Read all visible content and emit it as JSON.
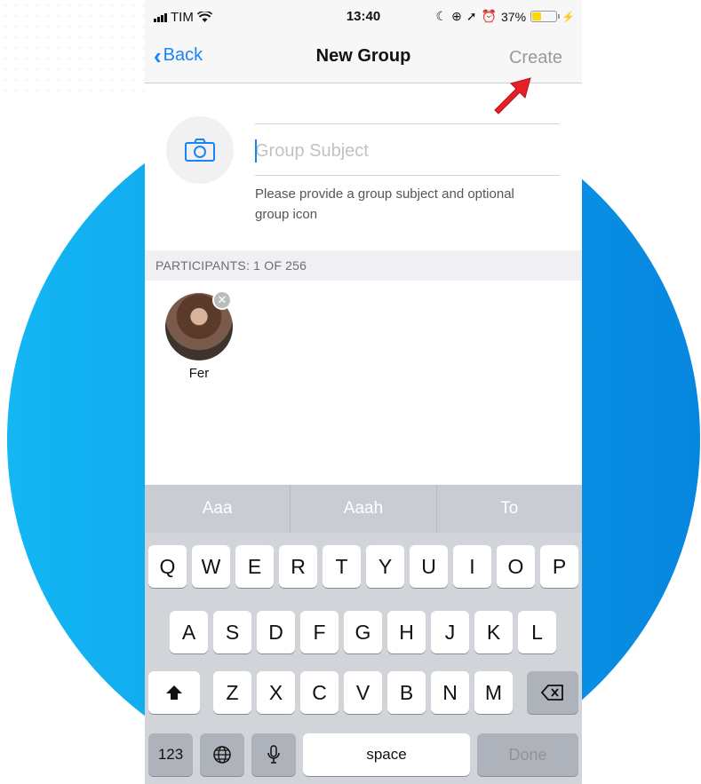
{
  "status_bar": {
    "carrier": "TIM",
    "time": "13:40",
    "battery": "37%"
  },
  "nav": {
    "back_label": "Back",
    "title": "New Group",
    "create_label": "Create"
  },
  "group": {
    "subject_placeholder": "Group Subject",
    "hint": "Please provide a group subject and optional group icon"
  },
  "participants": {
    "header": "PARTICIPANTS: 1 OF 256",
    "items": [
      {
        "name": "Fer"
      }
    ]
  },
  "keyboard": {
    "suggestions": [
      "Aaa",
      "Aaah",
      "To"
    ],
    "row1": [
      "Q",
      "W",
      "E",
      "R",
      "T",
      "Y",
      "U",
      "I",
      "O",
      "P"
    ],
    "row2": [
      "A",
      "S",
      "D",
      "F",
      "G",
      "H",
      "J",
      "K",
      "L"
    ],
    "row3": [
      "Z",
      "X",
      "C",
      "V",
      "B",
      "N",
      "M"
    ],
    "numbers_label": "123",
    "space_label": "space",
    "done_label": "Done"
  },
  "colors": {
    "accent": "#1a82fb",
    "arrow": "#e5202a",
    "circle": "#0a9de8"
  }
}
